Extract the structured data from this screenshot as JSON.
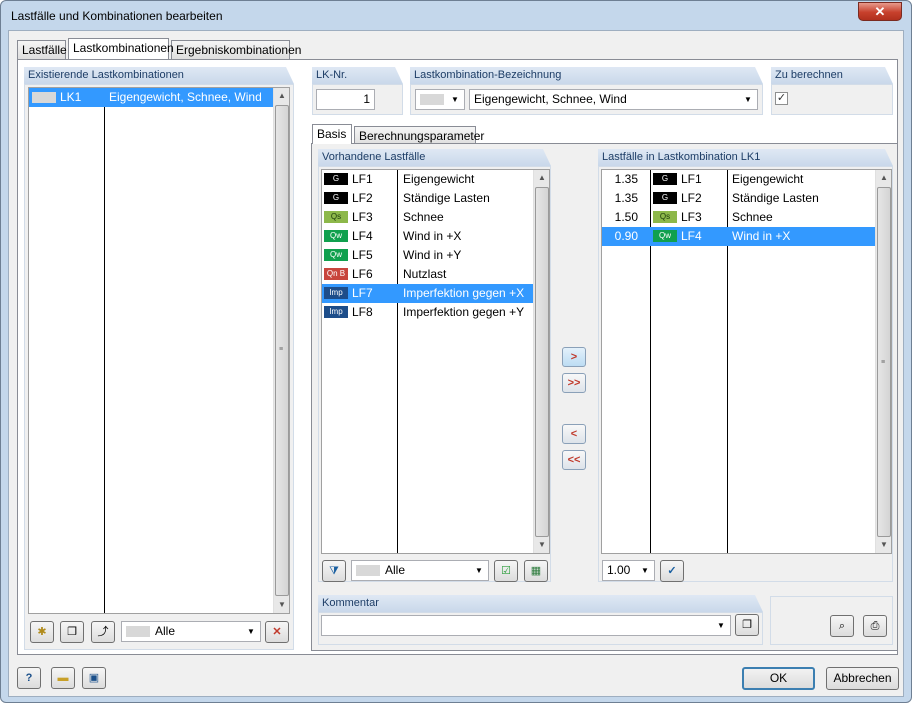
{
  "window": {
    "title": "Lastfälle und Kombinationen bearbeiten",
    "close_glyph": "✕"
  },
  "tabs": [
    "Lastfälle",
    "Lastkombinationen",
    "Ergebniskombinationen"
  ],
  "left": {
    "header": "Existierende Lastkombinationen",
    "rows": [
      {
        "id": "LK1",
        "name": "Eigengewicht, Schnee, Wind"
      }
    ],
    "filter": "Alle"
  },
  "lk": {
    "header": "LK-Nr.",
    "value": "1"
  },
  "bez": {
    "header": "Lastkombination-Bezeichnung",
    "value": "Eigengewicht, Schnee, Wind"
  },
  "berechnen": {
    "header": "Zu berechnen",
    "checked": "✓"
  },
  "subtabs": [
    "Basis",
    "Berechnungsparameter"
  ],
  "vorhanden": {
    "header": "Vorhandene Lastfälle",
    "rows": [
      {
        "badge": "G",
        "id": "LF1",
        "name": "Eigengewicht"
      },
      {
        "badge": "G",
        "id": "LF2",
        "name": "Ständige Lasten"
      },
      {
        "badge": "Qs",
        "id": "LF3",
        "name": "Schnee"
      },
      {
        "badge": "Qw",
        "id": "LF4",
        "name": "Wind in +X"
      },
      {
        "badge": "Qw",
        "id": "LF5",
        "name": "Wind in +Y"
      },
      {
        "badge": "Qn B",
        "id": "LF6",
        "name": "Nutzlast"
      },
      {
        "badge": "Imp",
        "id": "LF7",
        "name": "Imperfektion gegen +X"
      },
      {
        "badge": "Imp",
        "id": "LF8",
        "name": "Imperfektion gegen +Y"
      }
    ],
    "filter": "Alle"
  },
  "inkombi": {
    "header": "Lastfälle in Lastkombination LK1",
    "rows": [
      {
        "factor": "1.35",
        "badge": "G",
        "id": "LF1",
        "name": "Eigengewicht"
      },
      {
        "factor": "1.35",
        "badge": "G",
        "id": "LF2",
        "name": "Ständige Lasten"
      },
      {
        "factor": "1.50",
        "badge": "Qs",
        "id": "LF3",
        "name": "Schnee"
      },
      {
        "factor": "0.90",
        "badge": "Qw",
        "id": "LF4",
        "name": "Wind in +X"
      }
    ],
    "factor_select": "1.00"
  },
  "move": {
    "add": ">",
    "add_all": ">>",
    "remove": "<",
    "remove_all": "<<"
  },
  "kommentar": {
    "header": "Kommentar",
    "value": ""
  },
  "buttons": {
    "ok": "OK",
    "cancel": "Abbrechen"
  },
  "icons": {
    "help": "?",
    "delete": "✕",
    "apply": "✓",
    "filter": "▼"
  }
}
